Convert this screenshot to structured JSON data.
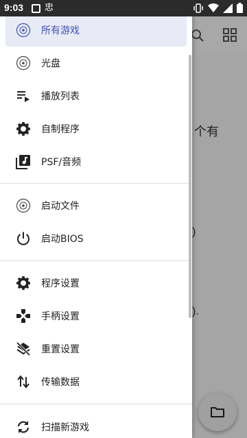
{
  "status_bar": {
    "time": "9:03",
    "notif_glyph": "忠"
  },
  "background": {
    "text_1": "个有",
    "text_2": ")",
    "text_3": ")."
  },
  "drawer": {
    "group1": [
      {
        "label": "所有游戏",
        "icon": "disc-icon",
        "selected": true
      },
      {
        "label": "光盘",
        "icon": "disc-icon"
      },
      {
        "label": "播放列表",
        "icon": "playlist-icon"
      },
      {
        "label": "自制程序",
        "icon": "gear-icon"
      },
      {
        "label": "PSF/音频",
        "icon": "music-library-icon"
      }
    ],
    "group2": [
      {
        "label": "启动文件",
        "icon": "disc-icon"
      },
      {
        "label": "启动BIOS",
        "icon": "power-icon"
      }
    ],
    "group3": [
      {
        "label": "程序设置",
        "icon": "gear-icon"
      },
      {
        "label": "手柄设置",
        "icon": "gamepad-icon"
      },
      {
        "label": "重置设置",
        "icon": "layers-off-icon"
      },
      {
        "label": "传输数据",
        "icon": "swap-vertical-icon"
      }
    ],
    "group4": [
      {
        "label": "扫描新游戏",
        "icon": "refresh-icon"
      }
    ]
  },
  "colors": {
    "accent": "#3f51b5",
    "selected_bg": "#e8eaf6",
    "status_bar": "#2b2b2b"
  }
}
